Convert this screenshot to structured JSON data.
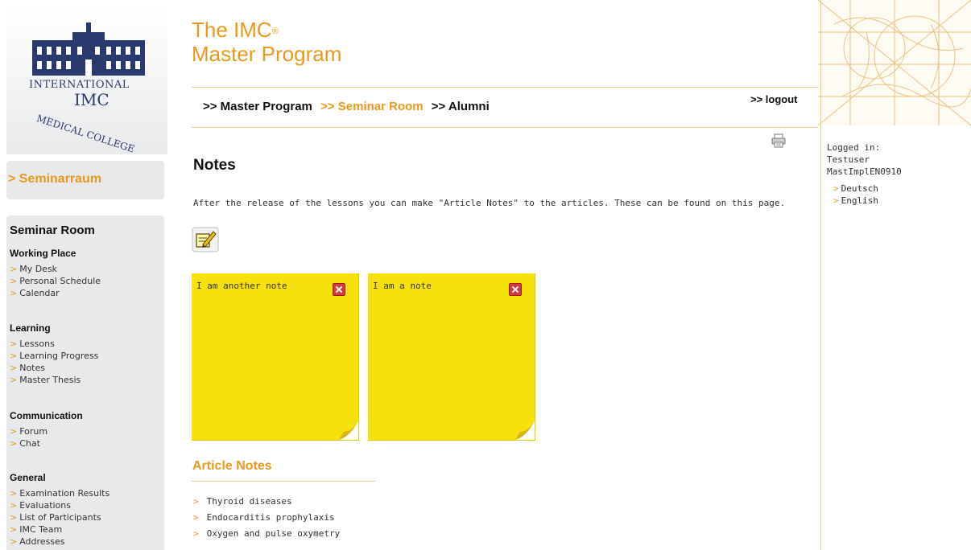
{
  "logo": {
    "line1": "INTERNATIONAL",
    "line2": "IMC",
    "arc_text": "MEDICAL COLLEGE"
  },
  "sidebar": {
    "section_label": "> Seminarraum",
    "title": "Seminar Room",
    "groups": [
      {
        "heading": "Working Place",
        "items": [
          "My Desk",
          "Personal Schedule",
          "Calendar"
        ]
      },
      {
        "heading": "Learning",
        "items": [
          "Lessons",
          "Learning Progress",
          "Notes",
          "Master Thesis"
        ]
      },
      {
        "heading": "Communication",
        "items": [
          "Forum",
          "Chat"
        ]
      },
      {
        "heading": "General",
        "items": [
          "Examination Results",
          "Evaluations",
          "List of Participants",
          "IMC Team",
          "Addresses"
        ]
      }
    ]
  },
  "header": {
    "brand_line1": "The IMC",
    "brand_reg": "®",
    "brand_line2": "Master Program",
    "breadcrumb": [
      ">> Master Program",
      ">> Seminar Room",
      ">> Alumni"
    ],
    "logout": ">> logout"
  },
  "user": {
    "logged_in_label": "Logged in:",
    "name": "Testuser",
    "account": "MastImplEN0910",
    "languages": [
      "Deutsch",
      "English"
    ]
  },
  "main": {
    "title": "Notes",
    "intro": "After the release of the lessons you can make \"Article Notes\" to the articles. These can be found on this page.",
    "notes": [
      "I am another note",
      "I am a note"
    ],
    "article_notes_title": "Article Notes",
    "articles": [
      "Thyroid diseases",
      "Endocarditis prophylaxis",
      "Oxygen and pulse oxymetry"
    ]
  },
  "colors": {
    "accent": "#e8991c",
    "note_yellow": "#f7e10a",
    "sidebar_bg": "#e8e9eb",
    "delete_red": "#d8393b"
  },
  "icons": {
    "print": "printer-icon",
    "add_note": "edit-note-icon",
    "delete_note": "close-icon"
  }
}
